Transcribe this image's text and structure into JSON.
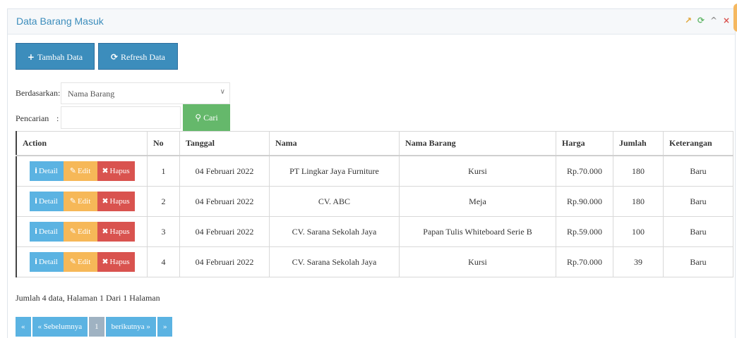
{
  "panel": {
    "title": "Data Barang Masuk",
    "tools": {
      "expand_icon": "↗",
      "refresh_icon": "⟳",
      "collapse_icon": "^",
      "close_icon": "×"
    }
  },
  "toolbar": {
    "add_label": "Tambah Data",
    "add_icon": "+",
    "refresh_label": "Refresh Data",
    "refresh_icon": "⟳"
  },
  "filters": {
    "based_on_label": "Berdasarkan:",
    "based_on_value": "Nama Barang",
    "search_label": "Pencarian",
    "search_colon": ":",
    "search_value": "",
    "search_button": "Cari",
    "search_icon": "⚲"
  },
  "table": {
    "headers": [
      "Action",
      "No",
      "Tanggal",
      "Nama",
      "Nama Barang",
      "Harga",
      "Jumlah",
      "Keterangan"
    ],
    "action_labels": {
      "detail": "Detail",
      "edit": "Edit",
      "delete": "Hapus",
      "detail_icon": "i",
      "edit_icon": "✎",
      "delete_icon": "✖"
    },
    "rows": [
      {
        "no": "1",
        "tanggal": "04 Februari 2022",
        "nama": "PT Lingkar Jaya Furniture",
        "barang": "Kursi",
        "harga": "Rp.70.000",
        "jumlah": "180",
        "ket": "Baru"
      },
      {
        "no": "2",
        "tanggal": "04 Februari 2022",
        "nama": "CV. ABC",
        "barang": "Meja",
        "harga": "Rp.90.000",
        "jumlah": "180",
        "ket": "Baru"
      },
      {
        "no": "3",
        "tanggal": "04 Februari 2022",
        "nama": "CV. Sarana Sekolah Jaya",
        "barang": "Papan Tulis Whiteboard Serie B",
        "harga": "Rp.59.000",
        "jumlah": "100",
        "ket": "Baru"
      },
      {
        "no": "4",
        "tanggal": "04 Februari 2022",
        "nama": "CV. Sarana Sekolah Jaya",
        "barang": "Kursi",
        "harga": "Rp.70.000",
        "jumlah": "39",
        "ket": "Baru"
      }
    ]
  },
  "summary": "Jumlah 4 data, Halaman 1 Dari 1 Halaman",
  "pagination": {
    "first": "«",
    "prev": "« Sebelumnya",
    "current": "1",
    "next": "berikutnya »",
    "last": "»"
  },
  "colors": {
    "primary": "#3c8dbc",
    "success": "#65b86b",
    "info": "#5bb3e2",
    "warning": "#f6b858",
    "danger": "#d9534f"
  }
}
